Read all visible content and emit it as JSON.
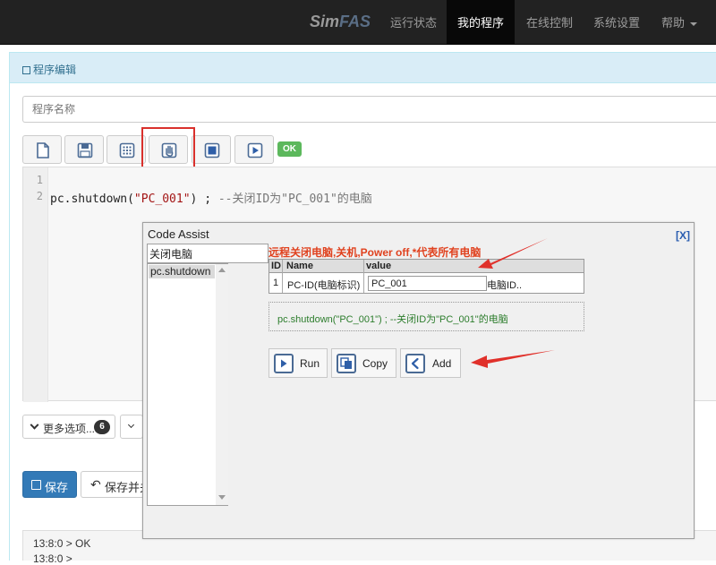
{
  "navbar": {
    "brand_part1": "Sim",
    "brand_part2": "FAS",
    "items": [
      {
        "label": "运行状态"
      },
      {
        "label": "我的程序"
      },
      {
        "label": "在线控制"
      },
      {
        "label": "系统设置"
      },
      {
        "label": "帮助"
      }
    ]
  },
  "panel": {
    "title": "程序编辑",
    "name_placeholder": "程序名称"
  },
  "toolbar": {
    "icons": [
      "new-file-icon",
      "save-icon",
      "grid-icon",
      "hand-icon",
      "stop-icon",
      "play-icon"
    ],
    "status_badge": "OK"
  },
  "editor": {
    "line_numbers": [
      "1",
      "2"
    ],
    "code_func": "pc.shutdown(",
    "code_string": "\"PC_001\"",
    "code_close": ") ; ",
    "code_comment": "--关闭ID为\"PC_001\"的电脑"
  },
  "options": {
    "more_label": "更多选项...",
    "more_count": "6"
  },
  "actions": {
    "save_label": "保存",
    "save_run_label": "保存并关"
  },
  "console": {
    "lines": [
      "13:8:0 > OK",
      "13:8:0 >"
    ]
  },
  "assist": {
    "title": "Code Assist",
    "close_label": "[X]",
    "search_value": "关闭电脑",
    "list_items": [
      "pc.shutdown"
    ],
    "description": "远程关闭电脑,关机,Power off,*代表所有电脑",
    "table_headers": [
      "ID",
      "Name",
      "value"
    ],
    "rows": [
      {
        "id": "1",
        "name": "PC-ID(电脑标识)",
        "value": "PC_001",
        "hint": "电脑ID.."
      }
    ],
    "preview": "pc.shutdown(\"PC_001\") ; --关闭ID为\"PC_001\"的电脑",
    "buttons": {
      "run": "Run",
      "copy": "Copy",
      "add": "Add"
    }
  },
  "colors": {
    "navbar_bg": "#222222",
    "panel_heading_bg": "#d9edf7",
    "primary": "#337ab7",
    "success": "#5cb85c",
    "annotation_red": "#d9302c"
  }
}
